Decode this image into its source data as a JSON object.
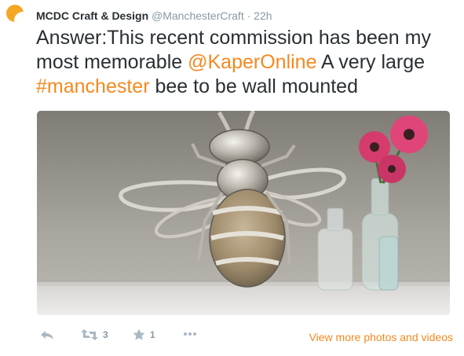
{
  "tweet": {
    "author_name": "MCDC Craft & Design",
    "author_handle": "@ManchesterCraft",
    "separator": "·",
    "timestamp": "22h",
    "text_parts": {
      "part1": "Answer:This recent commission has been my most memorable ",
      "mention": "@KaperOnline",
      "part2": " A very large ",
      "hashtag": "#manchester",
      "part3": " bee to be wall mounted"
    },
    "photo": {
      "subject": "large metal bee sculpture beside glass bottles and pink gerbera flowers"
    },
    "actions": {
      "reply_icon": "reply-icon",
      "retweet_icon": "retweet-icon",
      "retweet_count": "3",
      "favorite_icon": "star-icon",
      "favorite_count": "1",
      "more_icon": "ellipsis-icon",
      "view_more_label": "View more photos and videos"
    }
  },
  "colors": {
    "accent": "#f4891f",
    "muted": "#8899a6",
    "icon": "#aab8c2",
    "avatar": "#f5a623"
  }
}
